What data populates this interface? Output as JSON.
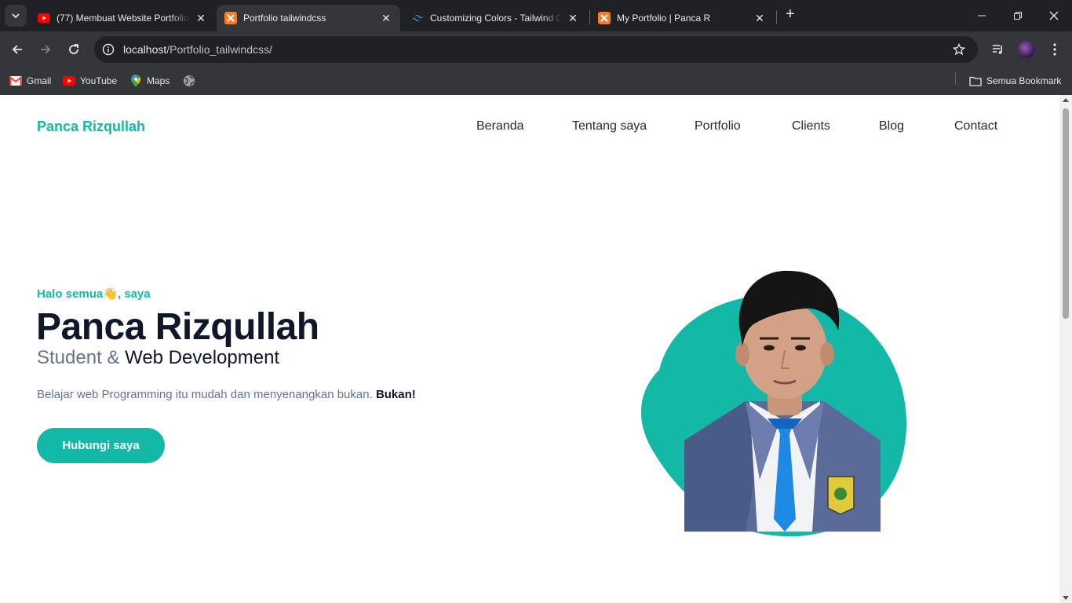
{
  "browser": {
    "tabs": [
      {
        "title": "(77) Membuat Website Portfolio",
        "favicon": "youtube-icon",
        "active": false
      },
      {
        "title": "Portfolio tailwindcss",
        "favicon": "xampp-icon",
        "active": true
      },
      {
        "title": "Customizing Colors - Tailwind CSS",
        "favicon": "tailwind-icon",
        "active": false
      },
      {
        "title": "My Portfolio | Panca R",
        "favicon": "xampp-icon",
        "active": false
      }
    ],
    "url_host": "localhost",
    "url_path": "/Portfolio_tailwindcss/",
    "bookmarks": [
      {
        "label": "Gmail",
        "icon": "gmail-icon"
      },
      {
        "label": "YouTube",
        "icon": "youtube-icon"
      },
      {
        "label": "Maps",
        "icon": "maps-icon"
      },
      {
        "label": "",
        "icon": "globe-icon"
      }
    ],
    "all_bookmarks_label": "Semua Bookmark"
  },
  "page": {
    "brand": "Panca Rizqullah",
    "nav": [
      "Beranda",
      "Tentang saya",
      "Portfolio",
      "Clients",
      "Blog",
      "Contact"
    ],
    "hero": {
      "greeting": "Halo semua",
      "greeting_emoji": "👋",
      "greeting_suffix": ", saya",
      "name": "Panca Rizqullah",
      "role_prefix": "Student &",
      "role_main": "Web Development",
      "description": "Belajar web Programming itu mudah dan menyenangkan bukan.",
      "description_bold": "Bukan!",
      "cta": "Hubungi saya"
    }
  },
  "colors": {
    "accent": "#14b8a6",
    "heading": "#0f172a",
    "muted": "#64748b"
  }
}
